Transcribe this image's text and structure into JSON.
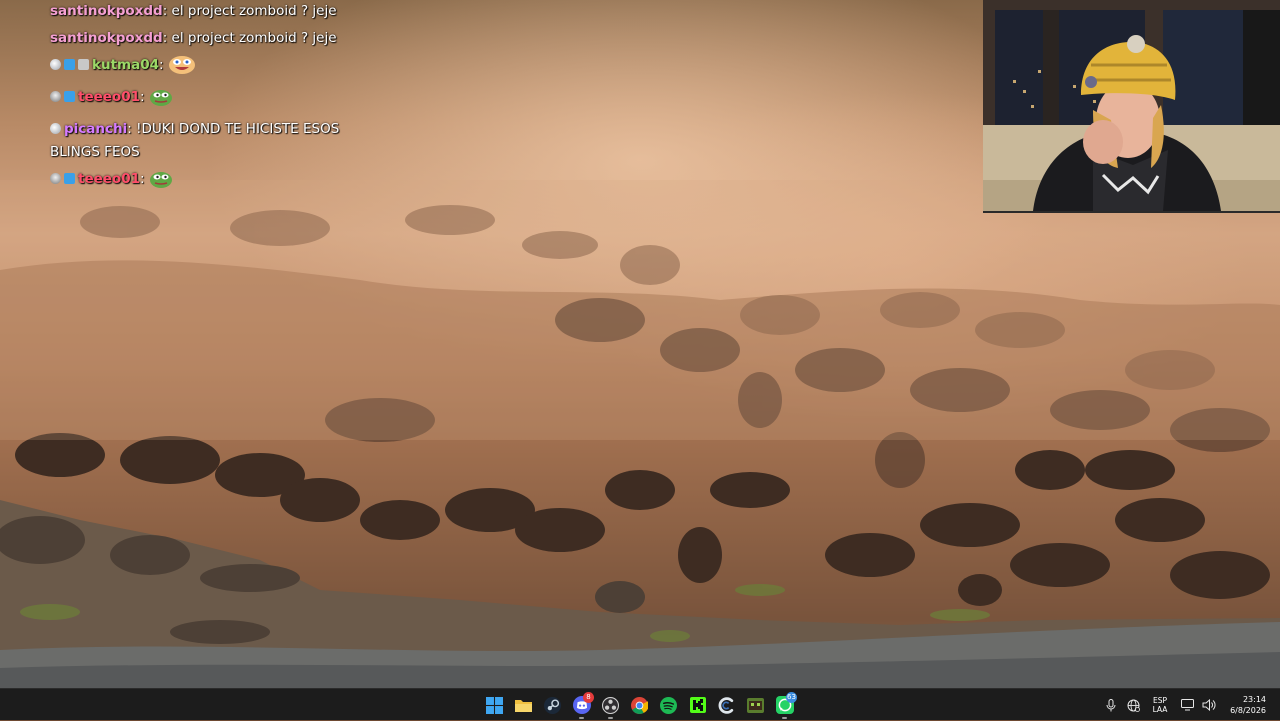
{
  "chat": {
    "messages": [
      {
        "user": "santinokpoxdd",
        "user_color": "#f5a0d2",
        "text": "el project zomboid ? jeje",
        "badges": [],
        "emote": null
      },
      {
        "user": "santinokpoxdd",
        "user_color": "#f5a0d2",
        "text": "el project zomboid ? jeje",
        "badges": [],
        "emote": null
      },
      {
        "user": "kutma04",
        "user_color": "#9cd867",
        "text": "",
        "badges": [
          "moon-badge",
          "cube-badge",
          "glasses-badge"
        ],
        "emote": "laughing-emote"
      },
      {
        "user": "teeeo01",
        "user_color": "#ff4f6a",
        "text": "",
        "badges": [
          "skull-badge",
          "cube-badge"
        ],
        "emote": "pepe-emote"
      },
      {
        "user": "picanchi",
        "user_color": "#d67bff",
        "text": "!DUKI DOND TE HICISTE ESOS BLINGS FEOS",
        "badges": [
          "moon-badge"
        ],
        "emote": null
      },
      {
        "user": "teeeo01",
        "user_color": "#ff4f6a",
        "text": "",
        "badges": [
          "skull-badge",
          "cube-badge"
        ],
        "emote": "pepe-emote"
      }
    ]
  },
  "webcam": {
    "label": "streamer-webcam"
  },
  "taskbar": {
    "apps": [
      {
        "name": "windows-start",
        "icon": "windows-icon",
        "running": false,
        "badge": ""
      },
      {
        "name": "file-explorer",
        "icon": "folder-icon",
        "running": false,
        "badge": ""
      },
      {
        "name": "steam",
        "icon": "steam-icon",
        "running": false,
        "badge": ""
      },
      {
        "name": "discord",
        "icon": "discord-icon",
        "running": true,
        "badge": "8"
      },
      {
        "name": "obs",
        "icon": "obs-icon",
        "running": true,
        "badge": ""
      },
      {
        "name": "chrome",
        "icon": "chrome-icon",
        "running": false,
        "badge": ""
      },
      {
        "name": "spotify",
        "icon": "spotify-icon",
        "running": false,
        "badge": ""
      },
      {
        "name": "kick",
        "icon": "kick-icon",
        "running": false,
        "badge": ""
      },
      {
        "name": "ccleaner",
        "icon": "ccleaner-icon",
        "running": false,
        "badge": ""
      },
      {
        "name": "minecraft",
        "icon": "minecraft-icon",
        "running": false,
        "badge": ""
      },
      {
        "name": "whatsapp",
        "icon": "whatsapp-icon",
        "running": true,
        "badge": "63"
      }
    ],
    "tray": {
      "language_line1": "ESP",
      "language_line2": "LAA",
      "time": "23:14",
      "date": "6/8/2026"
    },
    "colors": {
      "accent": "#0078d4",
      "whatsapp": "#25d366",
      "spotify": "#1db954",
      "kick": "#53fc18",
      "discord": "#5865f2"
    }
  }
}
